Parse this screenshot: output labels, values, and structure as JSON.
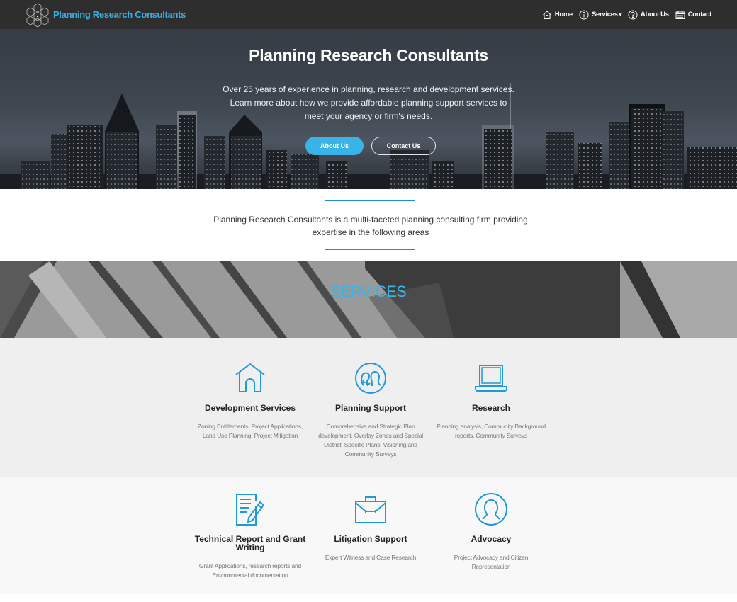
{
  "brand": {
    "name": "Planning Research Consultants"
  },
  "nav": {
    "items": [
      {
        "label": "Home",
        "icon": "home-icon"
      },
      {
        "label": "Services",
        "icon": "info-icon",
        "has_dropdown": true
      },
      {
        "label": "About Us",
        "icon": "question-icon"
      },
      {
        "label": "Contact",
        "icon": "calendar-icon"
      }
    ]
  },
  "hero": {
    "title": "Planning Research Consultants",
    "subtitle": "Over 25 years of experience in planning, research and development services. Learn more about how we provide affordable planning support services to meet your agency or firm's needs.",
    "about_button": "About Us",
    "contact_button": "Contact Us"
  },
  "intro": {
    "text": "Planning Research Consultants is a multi-faceted planning consulting firm providing expertise in the following areas"
  },
  "services": {
    "heading": "SERVICES",
    "items": [
      {
        "title": "Development Services",
        "icon": "house-icon",
        "description": "Zoning Entitlements, Project Applications, Land Use Planning, Project Mitigation"
      },
      {
        "title": "Planning Support",
        "icon": "people-exchange-icon",
        "description": "Comprehensive and Strategic Plan development, Overlay Zones and Special District, Specific Plans, Visioning and Community Surveys"
      },
      {
        "title": "Research",
        "icon": "laptop-icon",
        "description": "Planning analysis, Community Background reports, Community Surveys"
      },
      {
        "title": "Technical Report and Grant Writing",
        "icon": "document-pencil-icon",
        "description": "Grant Applications, research reports and Environmental documentation"
      },
      {
        "title": "Litigation Support",
        "icon": "briefcase-icon",
        "description": "Expert Witness and Case Research"
      },
      {
        "title": "Advocacy",
        "icon": "user-circle-icon",
        "description": "Project Advocacy and Citizen Representation"
      }
    ]
  },
  "colors": {
    "accent": "#3ab4e6",
    "navbar": "#2e2e2e",
    "rule": "#1e90c8"
  }
}
